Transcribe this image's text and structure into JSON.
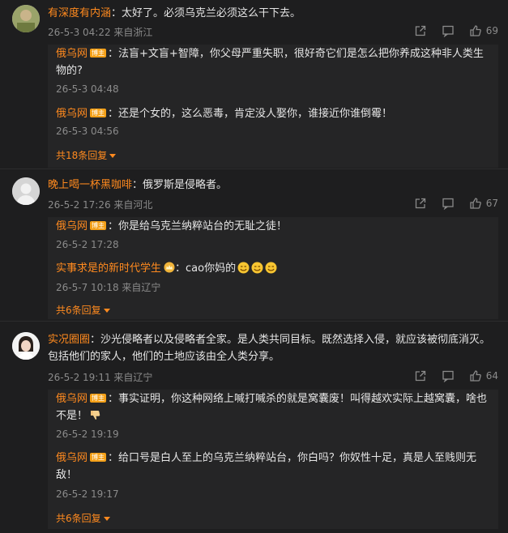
{
  "comments": [
    {
      "user": "有深度有内涵",
      "text": "太好了。必须乌克兰必须这么干下去。",
      "meta": "26-5-3 04:22 来自浙江",
      "likes": "69",
      "replies": [
        {
          "user": "俄乌网",
          "badge": "博主",
          "text": "法盲+文盲+智障，你父母严重失职，很好奇它们是怎么把你养成这种非人类生物的?",
          "meta": "26-5-3 04:48"
        },
        {
          "user": "俄乌网",
          "badge": "博主",
          "text": "还是个女的，这么恶毒，肯定没人娶你，谁接近你谁倒霉！",
          "meta": "26-5-3 04:56"
        }
      ],
      "more": "共18条回复"
    },
    {
      "user": "晚上喝一杯黑咖啡",
      "text": "俄罗斯是侵略者。",
      "meta": "26-5-2 17:26 来自河北",
      "likes": "67",
      "replies": [
        {
          "user": "俄乌网",
          "badge": "博主",
          "text": "你是给乌克兰纳粹站台的无耻之徒！",
          "meta": "26-5-2 17:28"
        },
        {
          "user": "实事求是的新时代学生",
          "text": "cao你妈的",
          "meta": "26-5-7 10:18 来自辽宁"
        }
      ],
      "more": "共6条回复"
    },
    {
      "user": "实况圈圈",
      "text": "沙光侵略者以及侵略者全家。是人类共同目标。既然选择入侵，就应该被彻底消灭。包括他们的家人，他们的土地应该由全人类分享。",
      "meta": "26-5-2 19:11 来自辽宁",
      "likes": "64",
      "replies": [
        {
          "user": "俄乌网",
          "badge": "博主",
          "text": "事实证明，你这种网络上喊打喊杀的就是窝囊废！叫得越欢实际上越窝囊，啥也不是！",
          "meta": "26-5-2 19:19"
        },
        {
          "user": "俄乌网",
          "badge": "博主",
          "text": "给口号是白人至上的乌克兰纳粹站台，你白吗？你奴性十足，真是人至贱则无敌！",
          "meta": "26-5-2 19:17"
        }
      ],
      "more": "共6条回复"
    }
  ],
  "icons": [
    "share-icon",
    "comment-icon",
    "like-icon",
    "caret-down-icon"
  ],
  "colors": {
    "accent": "#ff8a1f",
    "badge": "#f4a018",
    "background": "#1e1e1f",
    "reply_bg": "#252526"
  }
}
